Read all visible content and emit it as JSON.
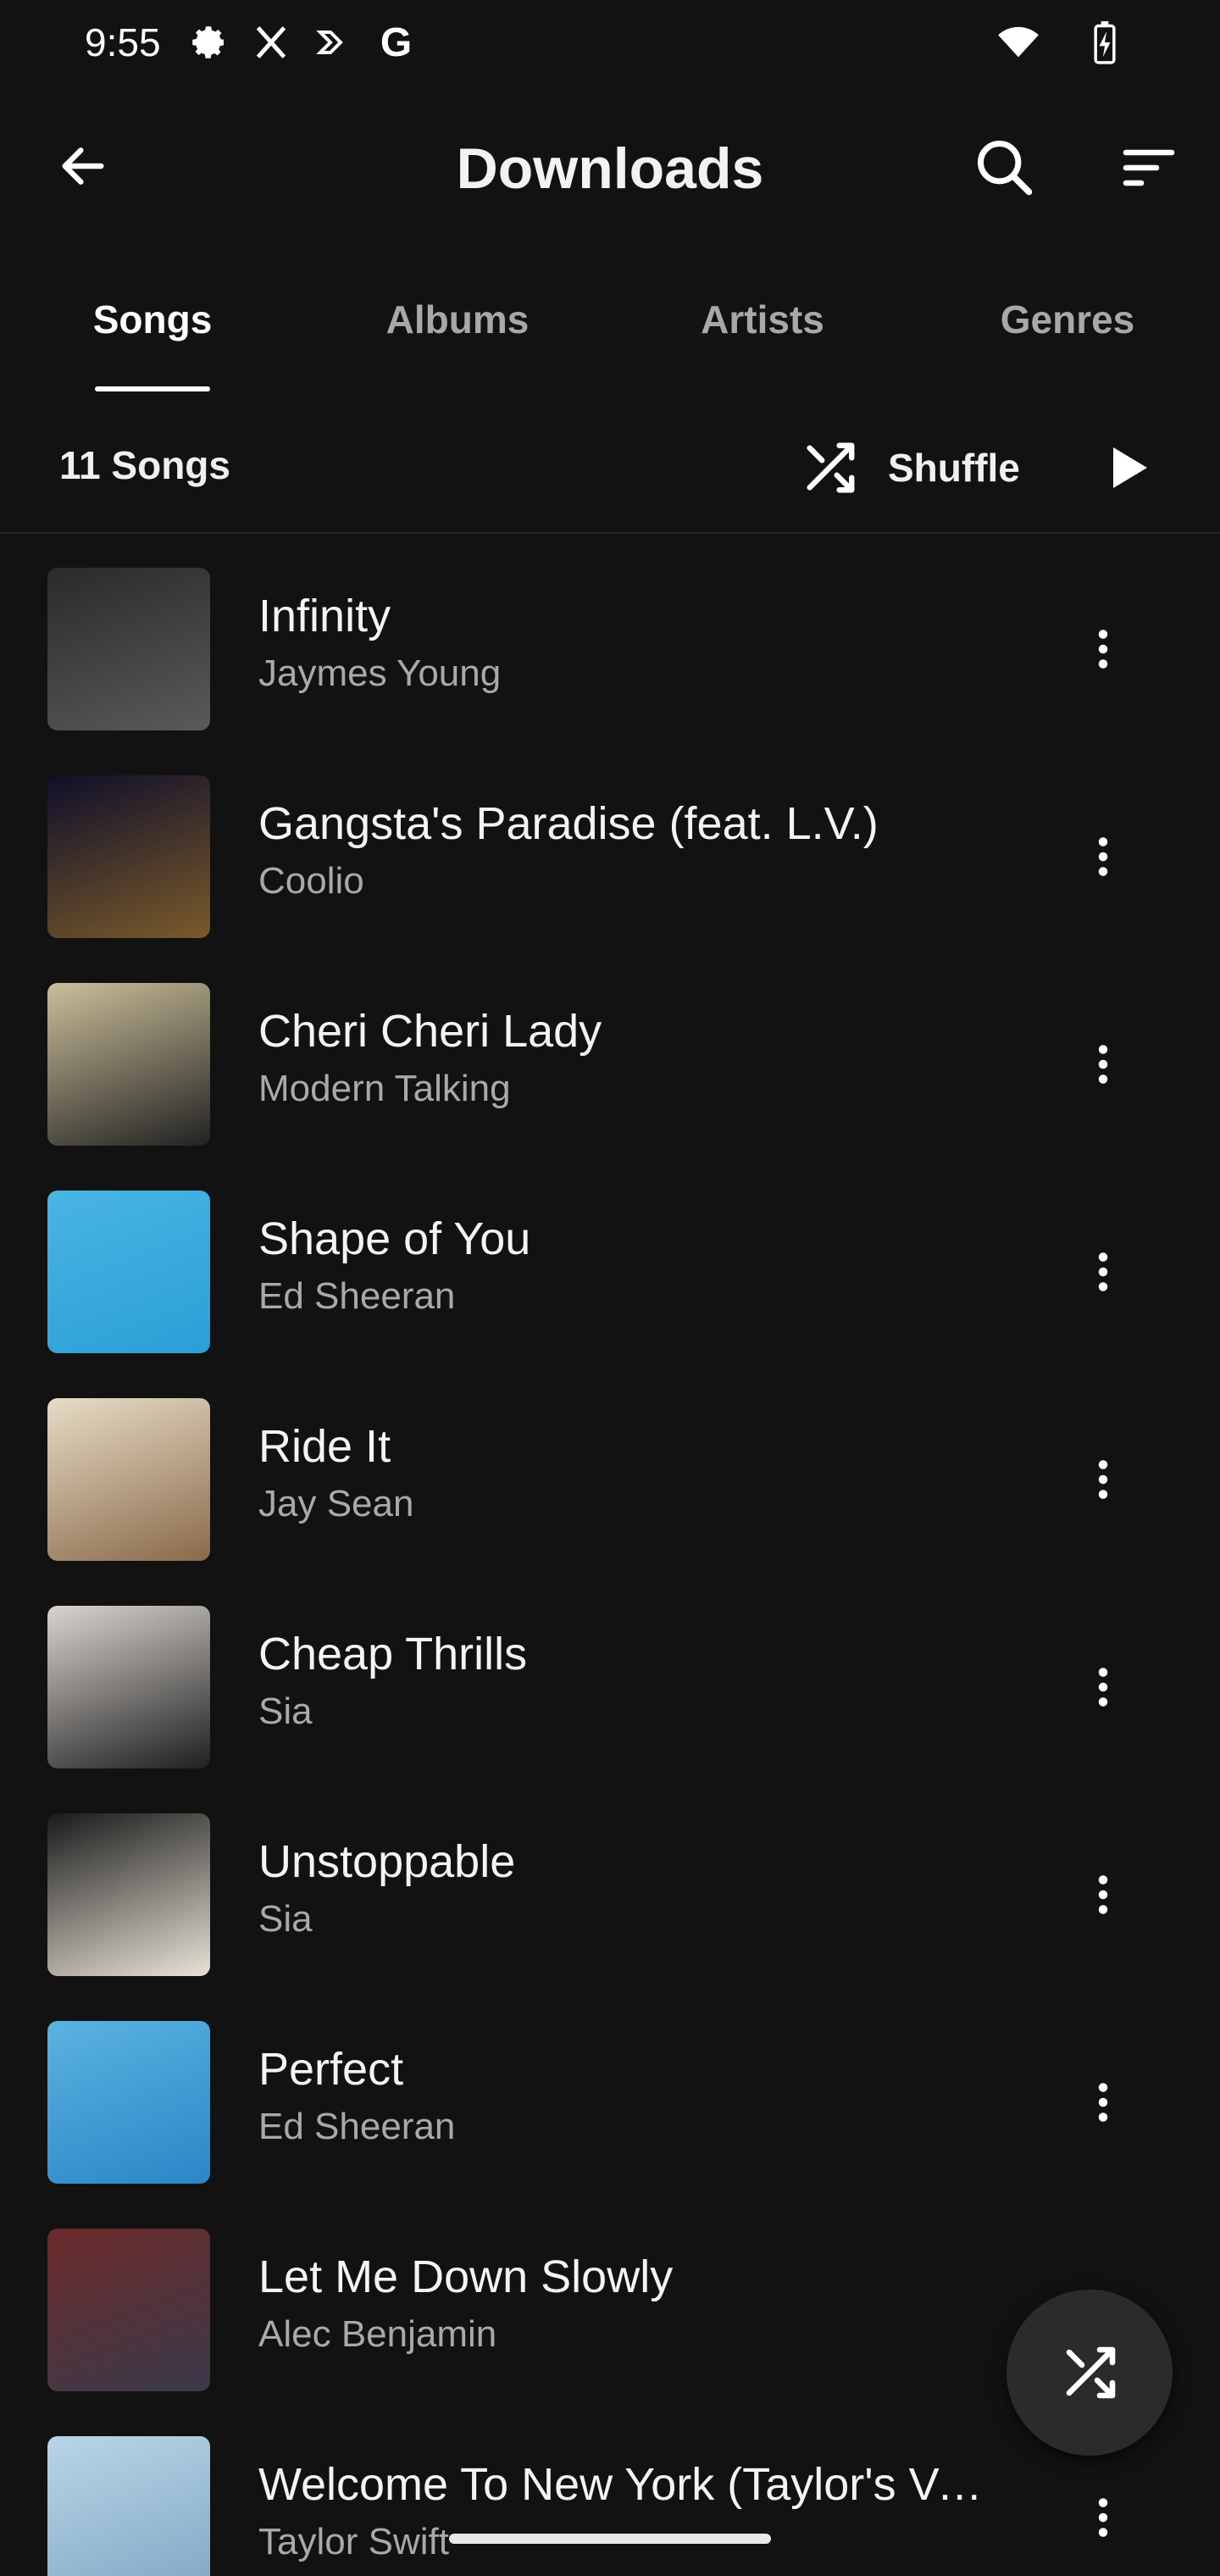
{
  "status_bar": {
    "time": "9:55",
    "icons_left": [
      "settings-icon",
      "x-logo-icon",
      "forward-arrow-icon",
      "google-g-icon"
    ],
    "icons_right": [
      "wifi-icon",
      "battery-charging-icon"
    ]
  },
  "app_bar": {
    "title": "Downloads",
    "back_icon": "arrow-left-icon",
    "search_icon": "search-icon",
    "sort_icon": "sort-icon"
  },
  "tabs": [
    {
      "label": "Songs",
      "active": true
    },
    {
      "label": "Albums",
      "active": false
    },
    {
      "label": "Artists",
      "active": false
    },
    {
      "label": "Genres",
      "active": false
    }
  ],
  "summary": {
    "count_label": "11 Songs",
    "shuffle_label": "Shuffle"
  },
  "songs": [
    {
      "title": "Infinity",
      "artist": "Jaymes Young",
      "art_colors": [
        "#2a2a2a",
        "#5a5a5a"
      ]
    },
    {
      "title": "Gangsta's Paradise (feat. L.V.)",
      "artist": "Coolio",
      "art_colors": [
        "#0f0f2a",
        "#7a5a2a"
      ]
    },
    {
      "title": "Cheri Cheri Lady",
      "artist": "Modern Talking",
      "art_colors": [
        "#cbbf9a",
        "#222222"
      ]
    },
    {
      "title": "Shape of You",
      "artist": "Ed Sheeran",
      "art_colors": [
        "#49b5e3",
        "#2a9fd6"
      ]
    },
    {
      "title": "Ride It",
      "artist": "Jay Sean",
      "art_colors": [
        "#e7dcc6",
        "#8a6a4a"
      ]
    },
    {
      "title": "Cheap Thrills",
      "artist": "Sia",
      "art_colors": [
        "#d9d4cf",
        "#202020"
      ]
    },
    {
      "title": "Unstoppable",
      "artist": "Sia",
      "art_colors": [
        "#1a1a1a",
        "#e8e2d6"
      ]
    },
    {
      "title": "Perfect",
      "artist": "Ed Sheeran",
      "art_colors": [
        "#5ab3e0",
        "#2b86c7"
      ]
    },
    {
      "title": "Let Me Down Slowly",
      "artist": "Alec Benjamin",
      "art_colors": [
        "#6b2a2a",
        "#3a3a4a"
      ]
    },
    {
      "title": "Welcome To New York (Taylor's Version)",
      "artist": "Taylor Swift",
      "art_colors": [
        "#b9d5e6",
        "#7fa7c4"
      ]
    }
  ],
  "fab": {
    "icon": "shuffle-icon"
  },
  "colors": {
    "background": "#121212",
    "text_primary": "#ffffff",
    "text_secondary": "#a9a9a9"
  }
}
